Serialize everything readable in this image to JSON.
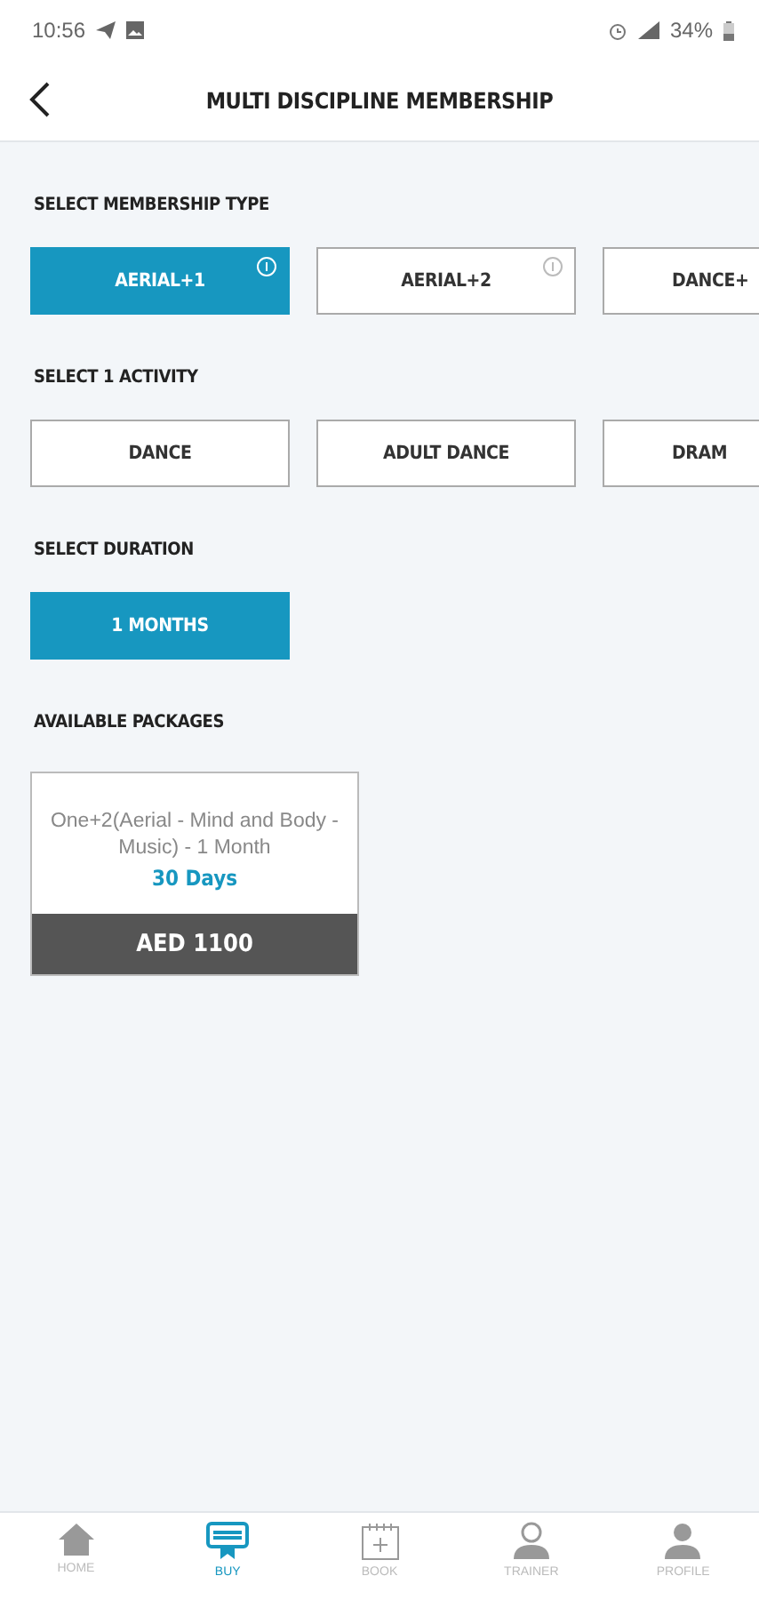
{
  "status_bar": {
    "time": "10:56",
    "battery": "34%"
  },
  "header": {
    "title": "MULTI DISCIPLINE MEMBERSHIP"
  },
  "sections": [
    {
      "title": "SELECT MEMBERSHIP TYPE",
      "options": [
        {
          "label": "AERIAL+1",
          "selected": true,
          "info": true
        },
        {
          "label": "AERIAL+2",
          "selected": false,
          "info": true
        },
        {
          "label": "DANCE+",
          "selected": false,
          "info": false
        }
      ]
    },
    {
      "title": "SELECT 1 ACTIVITY",
      "options": [
        {
          "label": "DANCE",
          "selected": false,
          "info": false
        },
        {
          "label": "ADULT DANCE",
          "selected": false,
          "info": false
        },
        {
          "label": "DRAM",
          "selected": false,
          "info": false
        }
      ]
    },
    {
      "title": "SELECT DURATION",
      "options": [
        {
          "label": "1 MONTHS",
          "selected": true,
          "info": false
        }
      ]
    }
  ],
  "packages": {
    "title": "AVAILABLE PACKAGES",
    "items": [
      {
        "name": "One+2(Aerial - Mind and Body - Music) - 1 Month",
        "duration": "30 Days",
        "price": "AED 1100"
      }
    ]
  },
  "bottom_nav": [
    {
      "label": "HOME",
      "kind": "home",
      "selected": false
    },
    {
      "label": "BUY",
      "kind": "buy",
      "selected": true
    },
    {
      "label": "BOOK",
      "kind": "book",
      "selected": false
    },
    {
      "label": "TRAINER",
      "kind": "trainer",
      "selected": false
    },
    {
      "label": "PROFILE",
      "kind": "profile",
      "selected": false
    }
  ]
}
